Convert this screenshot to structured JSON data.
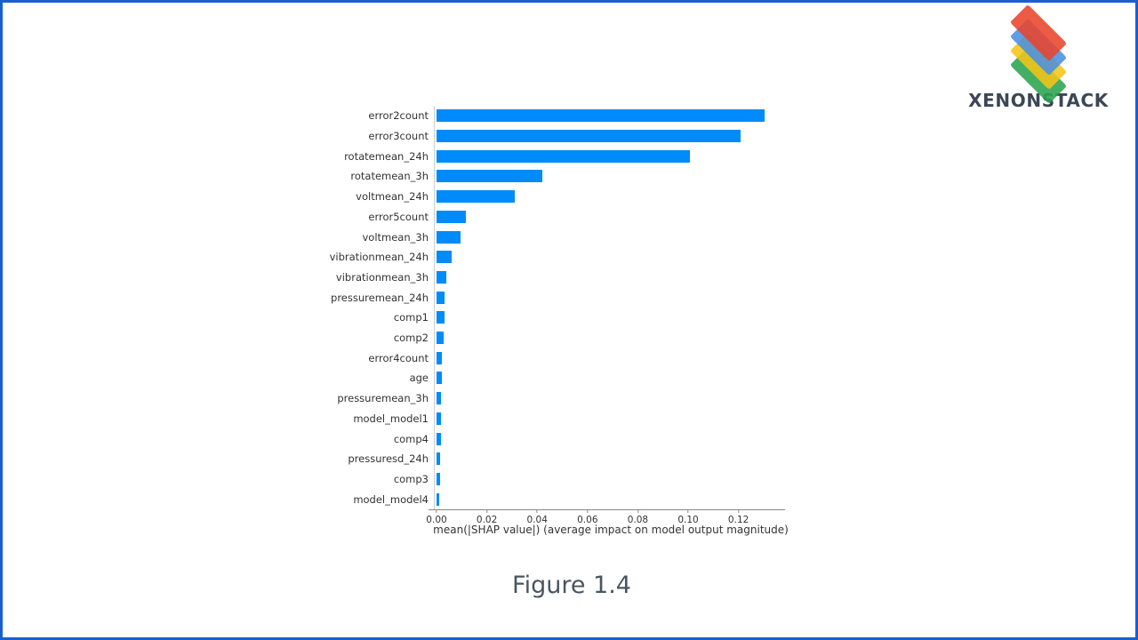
{
  "page": {
    "border_color": "#1a5fd0",
    "background": "#ffffff",
    "caption": "Figure 1.4"
  },
  "brand": {
    "name": "XENONSTACK",
    "logo_icon": "xenonstack-stacked-layers-logo",
    "layer_colors": [
      "#e8442c",
      "#4a90e2",
      "#f5c518",
      "#2aa44f"
    ]
  },
  "chart_data": {
    "type": "bar",
    "orientation": "horizontal",
    "title": "",
    "xlabel": "mean(|SHAP value|) (average impact on model output magnitude)",
    "ylabel": "",
    "bar_color": "#008bfb",
    "grid": false,
    "legend": false,
    "xlim": [
      0.0,
      0.1385
    ],
    "xticks": [
      "0.00",
      "0.02",
      "0.04",
      "0.06",
      "0.08",
      "0.10",
      "0.12"
    ],
    "xtick_values": [
      0.0,
      0.02,
      0.04,
      0.06,
      0.08,
      0.1,
      0.12
    ],
    "categories": [
      "error2count",
      "error3count",
      "rotatemean_24h",
      "rotatemean_3h",
      "voltmean_24h",
      "error5count",
      "voltmean_3h",
      "vibrationmean_24h",
      "vibrationmean_3h",
      "pressuremean_24h",
      "comp1",
      "comp2",
      "error4count",
      "age",
      "pressuremean_3h",
      "model_model1",
      "comp4",
      "pressuresd_24h",
      "comp3",
      "model_model4"
    ],
    "values": [
      0.1305,
      0.121,
      0.1007,
      0.0421,
      0.0312,
      0.0116,
      0.0095,
      0.006,
      0.0039,
      0.0032,
      0.0031,
      0.0028,
      0.0021,
      0.0021,
      0.0018,
      0.0017,
      0.0016,
      0.0015,
      0.0014,
      0.0012
    ]
  }
}
